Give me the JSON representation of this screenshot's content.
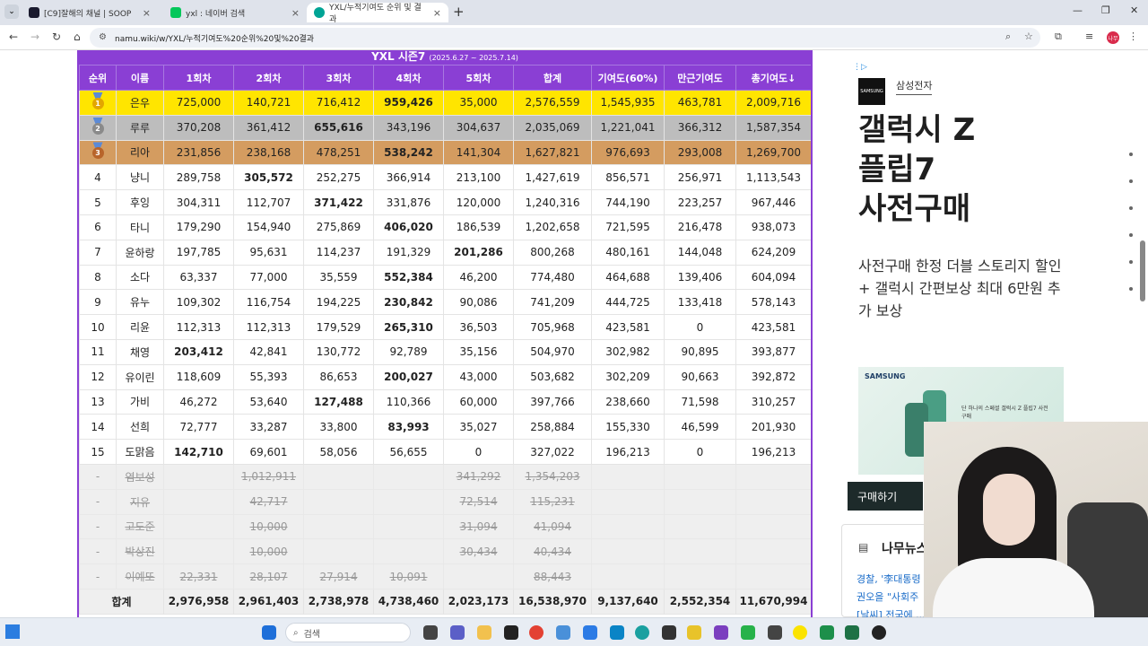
{
  "browser": {
    "tabs": [
      {
        "label": "[C9]잘해의 채널 | SOOP",
        "active": false
      },
      {
        "label": "yxl : 네이버 검색",
        "active": false
      },
      {
        "label": "YXL/누적기여도 순위 및 결과",
        "active": true
      }
    ],
    "url": "namu.wiki/w/YXL/누적기여도%20순위%20및%20결과",
    "profile_initials": "나무"
  },
  "table": {
    "season_title": "YXL 시즌7",
    "season_dates": "(2025.6.27 ~ 2025.7.14)",
    "headers": [
      "순위",
      "이름",
      "1회차",
      "2회차",
      "3회차",
      "4회차",
      "5회차",
      "합계",
      "기여도(60%)",
      "만근기여도",
      "총기여도↓"
    ],
    "rows": [
      {
        "rank": "1",
        "name": "은우",
        "r1": "725,000",
        "r2": "140,721",
        "r3": "716,412",
        "r4": "959,426",
        "r5": "35,000",
        "total": "2,576,559",
        "contrib": "1,545,935",
        "full": "463,781",
        "grand": "2,009,716"
      },
      {
        "rank": "2",
        "name": "루루",
        "r1": "370,208",
        "r2": "361,412",
        "r3": "655,616",
        "r4": "343,196",
        "r5": "304,637",
        "total": "2,035,069",
        "contrib": "1,221,041",
        "full": "366,312",
        "grand": "1,587,354"
      },
      {
        "rank": "3",
        "name": "리아",
        "r1": "231,856",
        "r2": "238,168",
        "r3": "478,251",
        "r4": "538,242",
        "r5": "141,304",
        "total": "1,627,821",
        "contrib": "976,693",
        "full": "293,008",
        "grand": "1,269,700"
      },
      {
        "rank": "4",
        "name": "냥니",
        "r1": "289,758",
        "r2": "305,572",
        "r3": "252,275",
        "r4": "366,914",
        "r5": "213,100",
        "total": "1,427,619",
        "contrib": "856,571",
        "full": "256,971",
        "grand": "1,113,543"
      },
      {
        "rank": "5",
        "name": "후잉",
        "r1": "304,311",
        "r2": "112,707",
        "r3": "371,422",
        "r4": "331,876",
        "r5": "120,000",
        "total": "1,240,316",
        "contrib": "744,190",
        "full": "223,257",
        "grand": "967,446"
      },
      {
        "rank": "6",
        "name": "타니",
        "r1": "179,290",
        "r2": "154,940",
        "r3": "275,869",
        "r4": "406,020",
        "r5": "186,539",
        "total": "1,202,658",
        "contrib": "721,595",
        "full": "216,478",
        "grand": "938,073"
      },
      {
        "rank": "7",
        "name": "윤하랑",
        "r1": "197,785",
        "r2": "95,631",
        "r3": "114,237",
        "r4": "191,329",
        "r5": "201,286",
        "total": "800,268",
        "contrib": "480,161",
        "full": "144,048",
        "grand": "624,209"
      },
      {
        "rank": "8",
        "name": "소다",
        "r1": "63,337",
        "r2": "77,000",
        "r3": "35,559",
        "r4": "552,384",
        "r5": "46,200",
        "total": "774,480",
        "contrib": "464,688",
        "full": "139,406",
        "grand": "604,094"
      },
      {
        "rank": "9",
        "name": "유누",
        "r1": "109,302",
        "r2": "116,754",
        "r3": "194,225",
        "r4": "230,842",
        "r5": "90,086",
        "total": "741,209",
        "contrib": "444,725",
        "full": "133,418",
        "grand": "578,143"
      },
      {
        "rank": "10",
        "name": "리윤",
        "r1": "112,313",
        "r2": "112,313",
        "r3": "179,529",
        "r4": "265,310",
        "r5": "36,503",
        "total": "705,968",
        "contrib": "423,581",
        "full": "0",
        "grand": "423,581"
      },
      {
        "rank": "11",
        "name": "채영",
        "r1": "203,412",
        "r2": "42,841",
        "r3": "130,772",
        "r4": "92,789",
        "r5": "35,156",
        "total": "504,970",
        "contrib": "302,982",
        "full": "90,895",
        "grand": "393,877"
      },
      {
        "rank": "12",
        "name": "유이린",
        "r1": "118,609",
        "r2": "55,393",
        "r3": "86,653",
        "r4": "200,027",
        "r5": "43,000",
        "total": "503,682",
        "contrib": "302,209",
        "full": "90,663",
        "grand": "392,872"
      },
      {
        "rank": "13",
        "name": "가비",
        "r1": "46,272",
        "r2": "53,640",
        "r3": "127,488",
        "r4": "110,366",
        "r5": "60,000",
        "total": "397,766",
        "contrib": "238,660",
        "full": "71,598",
        "grand": "310,257"
      },
      {
        "rank": "14",
        "name": "선희",
        "r1": "72,777",
        "r2": "33,287",
        "r3": "33,800",
        "r4": "83,993",
        "r5": "35,027",
        "total": "258,884",
        "contrib": "155,330",
        "full": "46,599",
        "grand": "201,930"
      },
      {
        "rank": "15",
        "name": "도맑음",
        "r1": "142,710",
        "r2": "69,601",
        "r3": "58,056",
        "r4": "56,655",
        "r5": "0",
        "total": "327,022",
        "contrib": "196,213",
        "full": "0",
        "grand": "196,213"
      }
    ],
    "out_rows": [
      {
        "rank": "-",
        "name": "염보성",
        "r1": "",
        "r2": "1,012,911",
        "r3": "",
        "r4": "",
        "r5": "341,292",
        "total": "1,354,203"
      },
      {
        "rank": "-",
        "name": "지유",
        "r1": "",
        "r2": "42,717",
        "r3": "",
        "r4": "",
        "r5": "72,514",
        "total": "115,231"
      },
      {
        "rank": "-",
        "name": "고도준",
        "r1": "",
        "r2": "10,000",
        "r3": "",
        "r4": "",
        "r5": "31,094",
        "total": "41,094"
      },
      {
        "rank": "-",
        "name": "박상진",
        "r1": "",
        "r2": "10,000",
        "r3": "",
        "r4": "",
        "r5": "30,434",
        "total": "40,434"
      },
      {
        "rank": "-",
        "name": "이예또",
        "r1": "22,331",
        "r2": "28,107",
        "r3": "27,914",
        "r4": "10,091",
        "r5": "",
        "total": "88,443"
      }
    ],
    "sum_row": {
      "label": "합계",
      "r1": "2,976,958",
      "r2": "2,961,403",
      "r3": "2,738,978",
      "r4": "4,738,460",
      "r5": "2,023,173",
      "total": "16,538,970",
      "contrib": "9,137,640",
      "full": "2,552,354",
      "grand": "11,670,994"
    }
  },
  "ad": {
    "brand": "삼성전자",
    "logo_text": "SAMSUNG",
    "headline": [
      "갤럭시 Z",
      "플립7",
      "사전구매"
    ],
    "subcopy": "사전구매 한정 더블 스토리지 할인 + 갤럭시 간편보상 최대 6만원 추가 보상",
    "image_brand": "SAMSUNG",
    "image_caption": "단 하나의 스페셜 갤럭시 Z 플립7 사전구매",
    "button": "구매하기"
  },
  "news": {
    "title": "나무뉴스",
    "items": [
      "경찰, '李대통령",
      "권오을 \"사회주",
      "[날씨] 전국에 ..."
    ]
  },
  "taskbar": {
    "search_placeholder": "검색"
  }
}
